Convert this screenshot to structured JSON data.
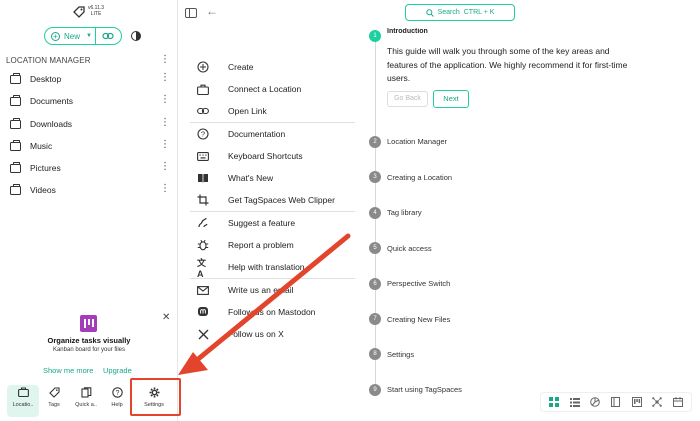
{
  "app": {
    "version_line1": "v6.11.3",
    "version_line2": "LITE",
    "accent": "#1dd19f",
    "accent_text": "#1aa888"
  },
  "sidebar": {
    "new_label": "New",
    "location_header": "LOCATION MANAGER",
    "locations": [
      {
        "label": "Desktop"
      },
      {
        "label": "Documents"
      },
      {
        "label": "Downloads"
      },
      {
        "label": "Music"
      },
      {
        "label": "Pictures"
      },
      {
        "label": "Videos"
      }
    ],
    "promo": {
      "title": "Organize tasks visually",
      "subtitle": "Kanban board for your files",
      "more": "Show me more",
      "upgrade": "Upgrade",
      "icon_color": "#a63db8"
    },
    "bottom_nav": [
      {
        "label": "Locatio..",
        "icon": "briefcase-icon"
      },
      {
        "label": "Tags",
        "icon": "tag-icon"
      },
      {
        "label": "Quick a..",
        "icon": "bookmark-icon"
      },
      {
        "label": "Help",
        "icon": "help-icon"
      },
      {
        "label": "Settings",
        "icon": "gear-icon"
      }
    ]
  },
  "toolbar": {
    "search_label": "Search",
    "search_shortcut": "CTRL + K"
  },
  "help_menu": [
    {
      "label": "Create",
      "icon": "plus-circle-icon"
    },
    {
      "label": "Connect a Location",
      "icon": "briefcase-icon"
    },
    {
      "label": "Open Link",
      "icon": "link-icon"
    },
    {
      "label": "Documentation",
      "icon": "help-icon"
    },
    {
      "label": "Keyboard Shortcuts",
      "icon": "keyboard-icon"
    },
    {
      "label": "What's New",
      "icon": "book-icon"
    },
    {
      "label": "Get TagSpaces Web Clipper",
      "icon": "crop-icon"
    },
    {
      "label": "Suggest a feature",
      "icon": "idea-icon"
    },
    {
      "label": "Report a problem",
      "icon": "bug-icon"
    },
    {
      "label": "Help with translation",
      "icon": "translate-icon"
    },
    {
      "label": "Write us an email",
      "icon": "mail-icon"
    },
    {
      "label": "Follow us on Mastodon",
      "icon": "mastodon-icon"
    },
    {
      "label": "Follow us on X",
      "icon": "x-icon"
    }
  ],
  "onboarding": {
    "intro_title": "Introduction",
    "intro_text": "This guide will walk you through some of the key areas and features of the application. We highly recommend it for first-time users.",
    "back_label": "Go Back",
    "next_label": "Next",
    "steps": [
      {
        "num": "1",
        "label": ""
      },
      {
        "num": "2",
        "label": "Location Manager"
      },
      {
        "num": "3",
        "label": "Creating a Location"
      },
      {
        "num": "4",
        "label": "Tag library"
      },
      {
        "num": "5",
        "label": "Quick access"
      },
      {
        "num": "6",
        "label": "Perspective Switch"
      },
      {
        "num": "7",
        "label": "Creating New Files"
      },
      {
        "num": "8",
        "label": "Settings"
      },
      {
        "num": "9",
        "label": "Start using TagSpaces"
      }
    ]
  },
  "perspectives": [
    "grid-icon",
    "list-icon",
    "gallery-icon",
    "book-icon",
    "kanban-icon",
    "mindmap-icon",
    "calendar-icon"
  ],
  "annotation_color": "#e2452c"
}
